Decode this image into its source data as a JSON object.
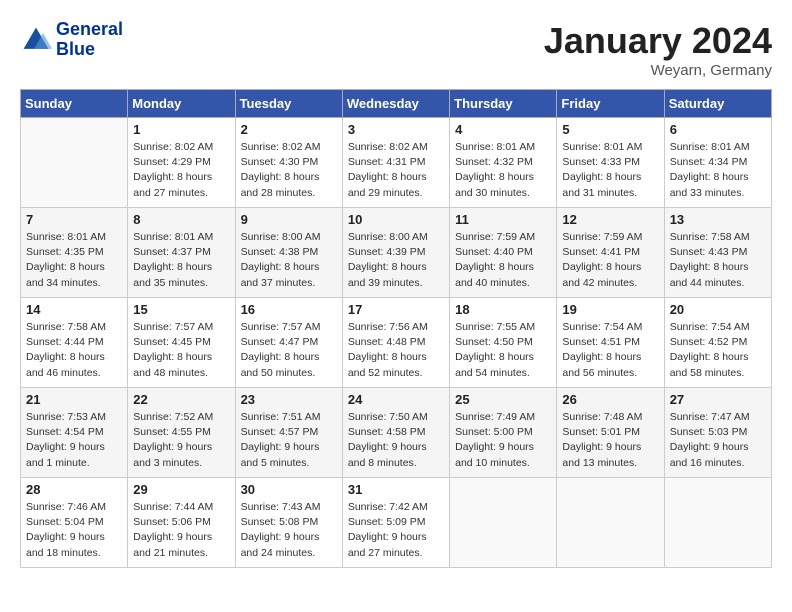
{
  "header": {
    "logo_line1": "General",
    "logo_line2": "Blue",
    "month": "January 2024",
    "location": "Weyarn, Germany"
  },
  "weekdays": [
    "Sunday",
    "Monday",
    "Tuesday",
    "Wednesday",
    "Thursday",
    "Friday",
    "Saturday"
  ],
  "weeks": [
    [
      {
        "day": "",
        "info": ""
      },
      {
        "day": "1",
        "info": "Sunrise: 8:02 AM\nSunset: 4:29 PM\nDaylight: 8 hours\nand 27 minutes."
      },
      {
        "day": "2",
        "info": "Sunrise: 8:02 AM\nSunset: 4:30 PM\nDaylight: 8 hours\nand 28 minutes."
      },
      {
        "day": "3",
        "info": "Sunrise: 8:02 AM\nSunset: 4:31 PM\nDaylight: 8 hours\nand 29 minutes."
      },
      {
        "day": "4",
        "info": "Sunrise: 8:01 AM\nSunset: 4:32 PM\nDaylight: 8 hours\nand 30 minutes."
      },
      {
        "day": "5",
        "info": "Sunrise: 8:01 AM\nSunset: 4:33 PM\nDaylight: 8 hours\nand 31 minutes."
      },
      {
        "day": "6",
        "info": "Sunrise: 8:01 AM\nSunset: 4:34 PM\nDaylight: 8 hours\nand 33 minutes."
      }
    ],
    [
      {
        "day": "7",
        "info": "Sunrise: 8:01 AM\nSunset: 4:35 PM\nDaylight: 8 hours\nand 34 minutes."
      },
      {
        "day": "8",
        "info": "Sunrise: 8:01 AM\nSunset: 4:37 PM\nDaylight: 8 hours\nand 35 minutes."
      },
      {
        "day": "9",
        "info": "Sunrise: 8:00 AM\nSunset: 4:38 PM\nDaylight: 8 hours\nand 37 minutes."
      },
      {
        "day": "10",
        "info": "Sunrise: 8:00 AM\nSunset: 4:39 PM\nDaylight: 8 hours\nand 39 minutes."
      },
      {
        "day": "11",
        "info": "Sunrise: 7:59 AM\nSunset: 4:40 PM\nDaylight: 8 hours\nand 40 minutes."
      },
      {
        "day": "12",
        "info": "Sunrise: 7:59 AM\nSunset: 4:41 PM\nDaylight: 8 hours\nand 42 minutes."
      },
      {
        "day": "13",
        "info": "Sunrise: 7:58 AM\nSunset: 4:43 PM\nDaylight: 8 hours\nand 44 minutes."
      }
    ],
    [
      {
        "day": "14",
        "info": "Sunrise: 7:58 AM\nSunset: 4:44 PM\nDaylight: 8 hours\nand 46 minutes."
      },
      {
        "day": "15",
        "info": "Sunrise: 7:57 AM\nSunset: 4:45 PM\nDaylight: 8 hours\nand 48 minutes."
      },
      {
        "day": "16",
        "info": "Sunrise: 7:57 AM\nSunset: 4:47 PM\nDaylight: 8 hours\nand 50 minutes."
      },
      {
        "day": "17",
        "info": "Sunrise: 7:56 AM\nSunset: 4:48 PM\nDaylight: 8 hours\nand 52 minutes."
      },
      {
        "day": "18",
        "info": "Sunrise: 7:55 AM\nSunset: 4:50 PM\nDaylight: 8 hours\nand 54 minutes."
      },
      {
        "day": "19",
        "info": "Sunrise: 7:54 AM\nSunset: 4:51 PM\nDaylight: 8 hours\nand 56 minutes."
      },
      {
        "day": "20",
        "info": "Sunrise: 7:54 AM\nSunset: 4:52 PM\nDaylight: 8 hours\nand 58 minutes."
      }
    ],
    [
      {
        "day": "21",
        "info": "Sunrise: 7:53 AM\nSunset: 4:54 PM\nDaylight: 9 hours\nand 1 minute."
      },
      {
        "day": "22",
        "info": "Sunrise: 7:52 AM\nSunset: 4:55 PM\nDaylight: 9 hours\nand 3 minutes."
      },
      {
        "day": "23",
        "info": "Sunrise: 7:51 AM\nSunset: 4:57 PM\nDaylight: 9 hours\nand 5 minutes."
      },
      {
        "day": "24",
        "info": "Sunrise: 7:50 AM\nSunset: 4:58 PM\nDaylight: 9 hours\nand 8 minutes."
      },
      {
        "day": "25",
        "info": "Sunrise: 7:49 AM\nSunset: 5:00 PM\nDaylight: 9 hours\nand 10 minutes."
      },
      {
        "day": "26",
        "info": "Sunrise: 7:48 AM\nSunset: 5:01 PM\nDaylight: 9 hours\nand 13 minutes."
      },
      {
        "day": "27",
        "info": "Sunrise: 7:47 AM\nSunset: 5:03 PM\nDaylight: 9 hours\nand 16 minutes."
      }
    ],
    [
      {
        "day": "28",
        "info": "Sunrise: 7:46 AM\nSunset: 5:04 PM\nDaylight: 9 hours\nand 18 minutes."
      },
      {
        "day": "29",
        "info": "Sunrise: 7:44 AM\nSunset: 5:06 PM\nDaylight: 9 hours\nand 21 minutes."
      },
      {
        "day": "30",
        "info": "Sunrise: 7:43 AM\nSunset: 5:08 PM\nDaylight: 9 hours\nand 24 minutes."
      },
      {
        "day": "31",
        "info": "Sunrise: 7:42 AM\nSunset: 5:09 PM\nDaylight: 9 hours\nand 27 minutes."
      },
      {
        "day": "",
        "info": ""
      },
      {
        "day": "",
        "info": ""
      },
      {
        "day": "",
        "info": ""
      }
    ]
  ]
}
